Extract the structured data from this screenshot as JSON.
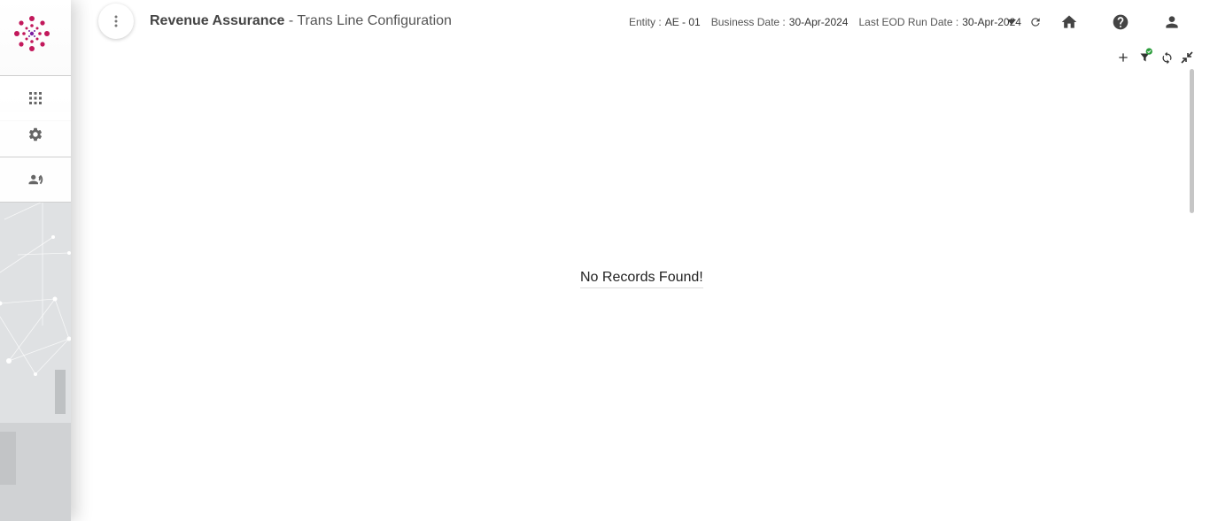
{
  "header": {
    "app_name": "Revenue Assurance",
    "page_title": "- Trans Line Configuration",
    "entity_label": "Entity :",
    "entity_value": "AE - 01",
    "business_date_label": "Business Date :",
    "business_date_value": "30-Apr-2024",
    "last_eod_label": "Last EOD Run Date :",
    "last_eod_value": "30-Apr-2024"
  },
  "sidebar": {
    "items": [
      {
        "icon": "apps-grid-icon"
      },
      {
        "icon": "gear-icon"
      },
      {
        "icon": "users-icon"
      }
    ]
  },
  "toolbar": {
    "icons": [
      "add-icon",
      "filter-applied-icon",
      "refresh-icon",
      "collapse-icon"
    ]
  },
  "main": {
    "empty_message": "No Records Found!"
  },
  "colors": {
    "brand": "#c2185b",
    "filter_badge": "#2e9e3e"
  }
}
